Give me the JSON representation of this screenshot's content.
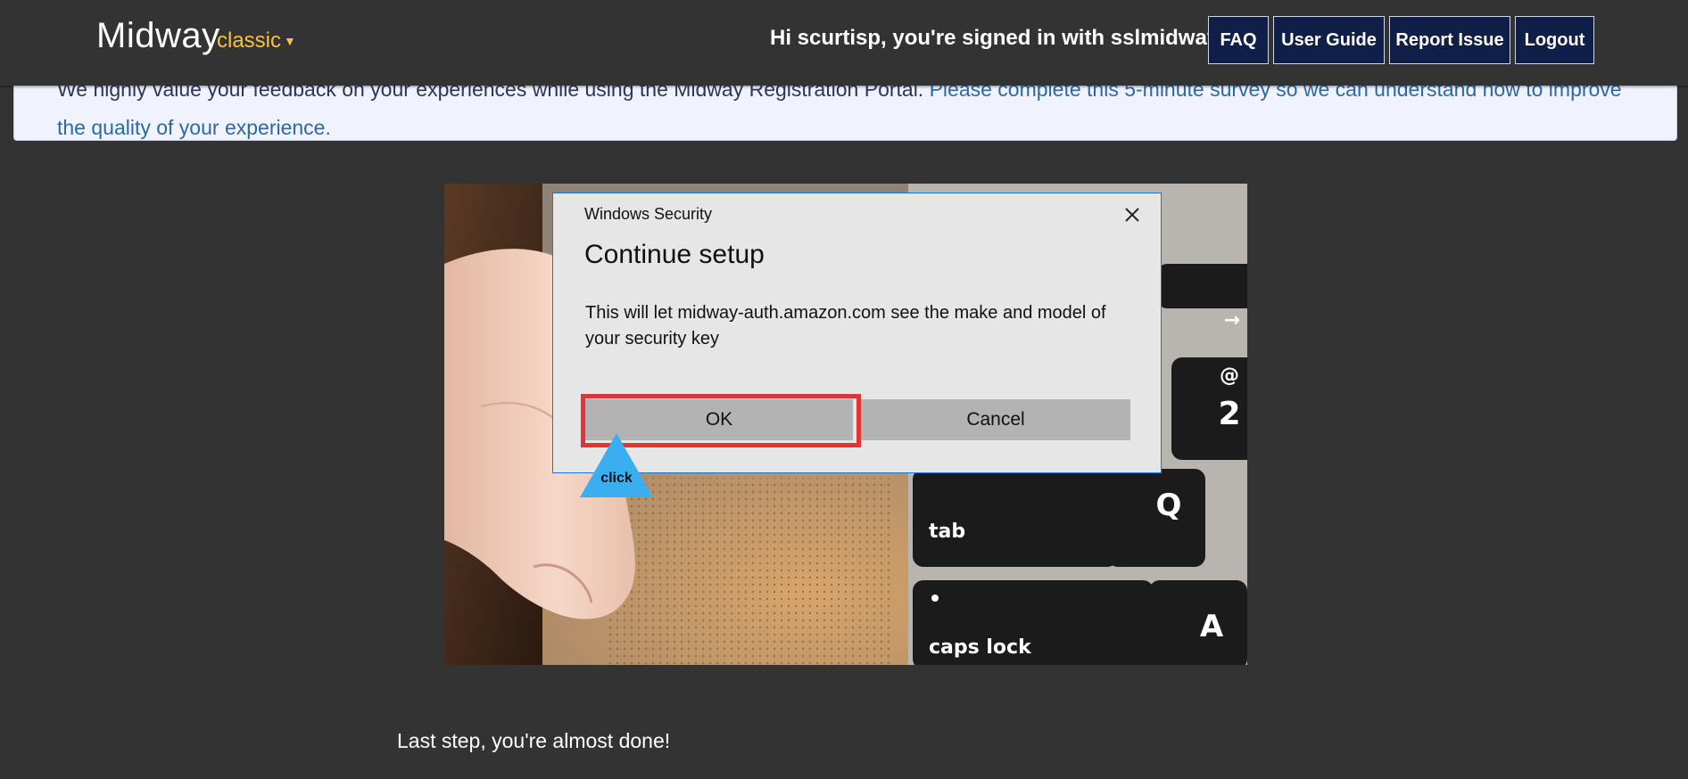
{
  "header": {
    "brand": "Midway",
    "brand_variant": "classic",
    "greeting": "Hi scurtisp, you're signed in with sslmidway",
    "nav": [
      "FAQ",
      "User Guide",
      "Report Issue",
      "Logout"
    ]
  },
  "banner": {
    "text": "We highly value your feedback on your experiences while using the Midway Registration Portal. ",
    "link_text": "Please complete this 5-minute survey so we can understand how to improve the quality of your experience."
  },
  "hero": {
    "keys": {
      "at_symbol": "@",
      "two": "2",
      "q": "Q",
      "a": "A",
      "tab": "tab",
      "caps_lock": "caps lock",
      "arrow": "→"
    }
  },
  "dialog": {
    "title": "Windows Security",
    "heading": "Continue setup",
    "body": "This will let midway-auth.amazon.com see the make and model of your security key",
    "ok_label": "OK",
    "cancel_label": "Cancel"
  },
  "hint": {
    "label": "click"
  },
  "footer": {
    "last_step": "Last step, you're almost done!"
  },
  "colors": {
    "page_bg": "#333333",
    "accent": "#f6c244",
    "nav_bg": "#0f1f48",
    "link": "#2c6aa0",
    "dialog_border": "#1b77d4",
    "highlight": "#e23434",
    "hint": "#3aaef0"
  }
}
